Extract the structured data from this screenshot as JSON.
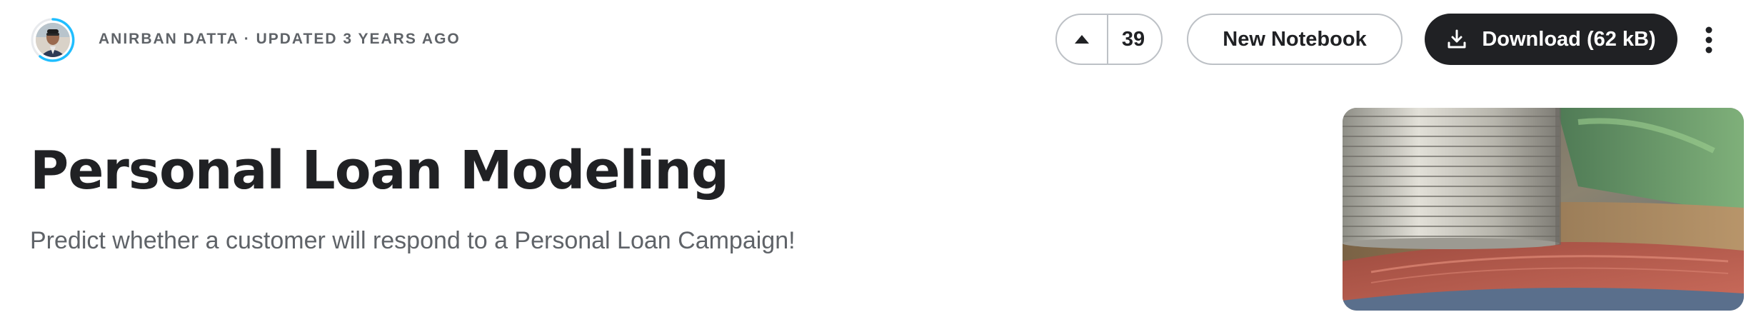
{
  "header": {
    "byline": "Anirban Datta · Updated 3 years ago",
    "avatar_icon": "user-avatar-photo",
    "vote": {
      "icon": "upvote-arrow-icon",
      "count": "39"
    },
    "new_notebook_label": "New Notebook",
    "download": {
      "icon": "download-icon",
      "label": "Download (62 kB)"
    },
    "more_icon": "kebab-menu-icon"
  },
  "dataset": {
    "title": "Personal Loan Modeling",
    "subtitle": "Predict whether a customer will respond to a Personal Loan Campaign!",
    "cover_image": "coin-stack-on-banknotes"
  },
  "colors": {
    "primary_dark": "#202124",
    "muted_text": "#5f6368",
    "border": "#bdc1c6",
    "progress_ring": "#20beff"
  }
}
